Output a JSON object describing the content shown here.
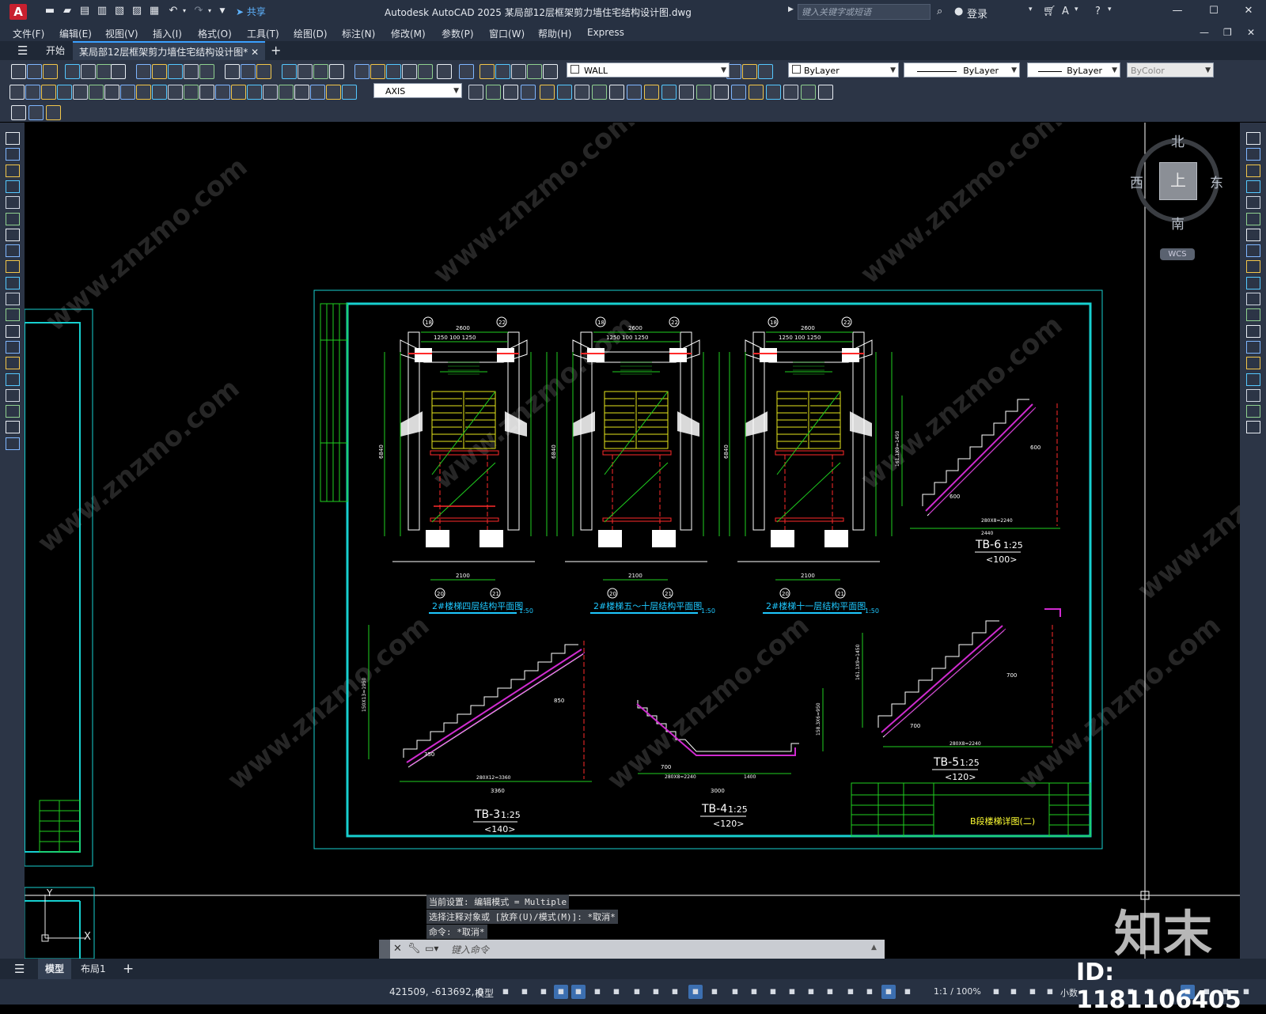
{
  "titlebar": {
    "logo": "A",
    "share_label": "共享",
    "app_title": "Autodesk AutoCAD 2025    某局部12层框架剪力墙住宅结构设计图.dwg",
    "search_placeholder": "键入关键字或短语",
    "login_label": "登录"
  },
  "menu": {
    "items": [
      "文件(F)",
      "编辑(E)",
      "视图(V)",
      "插入(I)",
      "格式(O)",
      "工具(T)",
      "绘图(D)",
      "标注(N)",
      "修改(M)",
      "参数(P)",
      "窗口(W)",
      "帮助(H)",
      "Express"
    ]
  },
  "tabs": {
    "start": "开始",
    "drawing": "某局部12层框架剪力墙住宅结构设计图*"
  },
  "toolbar": {
    "layer_value": "WALL",
    "color_value": "ByLayer",
    "linetype_value": "ByLayer",
    "lineweight_value": "ByLayer",
    "plotstyle_value": "ByColor",
    "dimstyle_value": "AXIS"
  },
  "viewcube": {
    "north": "北",
    "south": "南",
    "east": "东",
    "west": "西",
    "top": "上",
    "wcs": "WCS"
  },
  "drawing": {
    "plan1_title": "2#楼梯四层结构平面图",
    "plan2_title": "2#楼梯五～十层结构平面图",
    "plan3_title": "2#楼梯十一层结构平面图",
    "plan_scale": "1:50",
    "axis_18": "18",
    "axis_22": "22",
    "axis_20": "20",
    "axis_21": "21",
    "dim_2600": "2600",
    "dim_1250_100_1250": "1250  100  1250",
    "dim_2100": "2100",
    "dim_6840": "6840",
    "tb6_title": "TB-6",
    "tb6_scale": "1:25",
    "tb6_sub": "<100>",
    "tb3_title": "TB-3",
    "tb3_scale": "1:25",
    "tb3_sub": "<140>",
    "tb4_title": "TB-4",
    "tb4_scale": "1:25",
    "tb4_sub": "<120>",
    "tb5_title": "TB-5",
    "tb5_scale": "1:25",
    "tb5_sub": "<120>",
    "dim_3360": "3360",
    "dim_280x12": "280X12=3360",
    "dim_850": "850",
    "dim_350": "350",
    "dim_3000": "3000",
    "dim_1400": "1400",
    "dim_700": "700",
    "dim_600": "600",
    "dim_2440": "2440",
    "dim_280x8": "280X8=2240",
    "dim_1950": "150X13=1950",
    "dim_1450": "161.1X9=1450",
    "dim_950": "158.3X6=950",
    "title_block_name": "B段楼梯详图(二)"
  },
  "command": {
    "history1": "当前设置: 编辑模式 = Multiple",
    "history2": "选择注释对象或 [放弃(U)/模式(M)]: *取消*",
    "history3": "命令: *取消*",
    "placeholder": "键入命令"
  },
  "layouts": {
    "model": "模型",
    "layout1": "布局1"
  },
  "status": {
    "coords": "421509, -613692, 0",
    "model": "模型",
    "scale": "1:1 / 100%",
    "units": "小数"
  },
  "watermark": {
    "brand": "知末",
    "id": "ID: 1181106405",
    "site": "www.znzmo.com"
  }
}
